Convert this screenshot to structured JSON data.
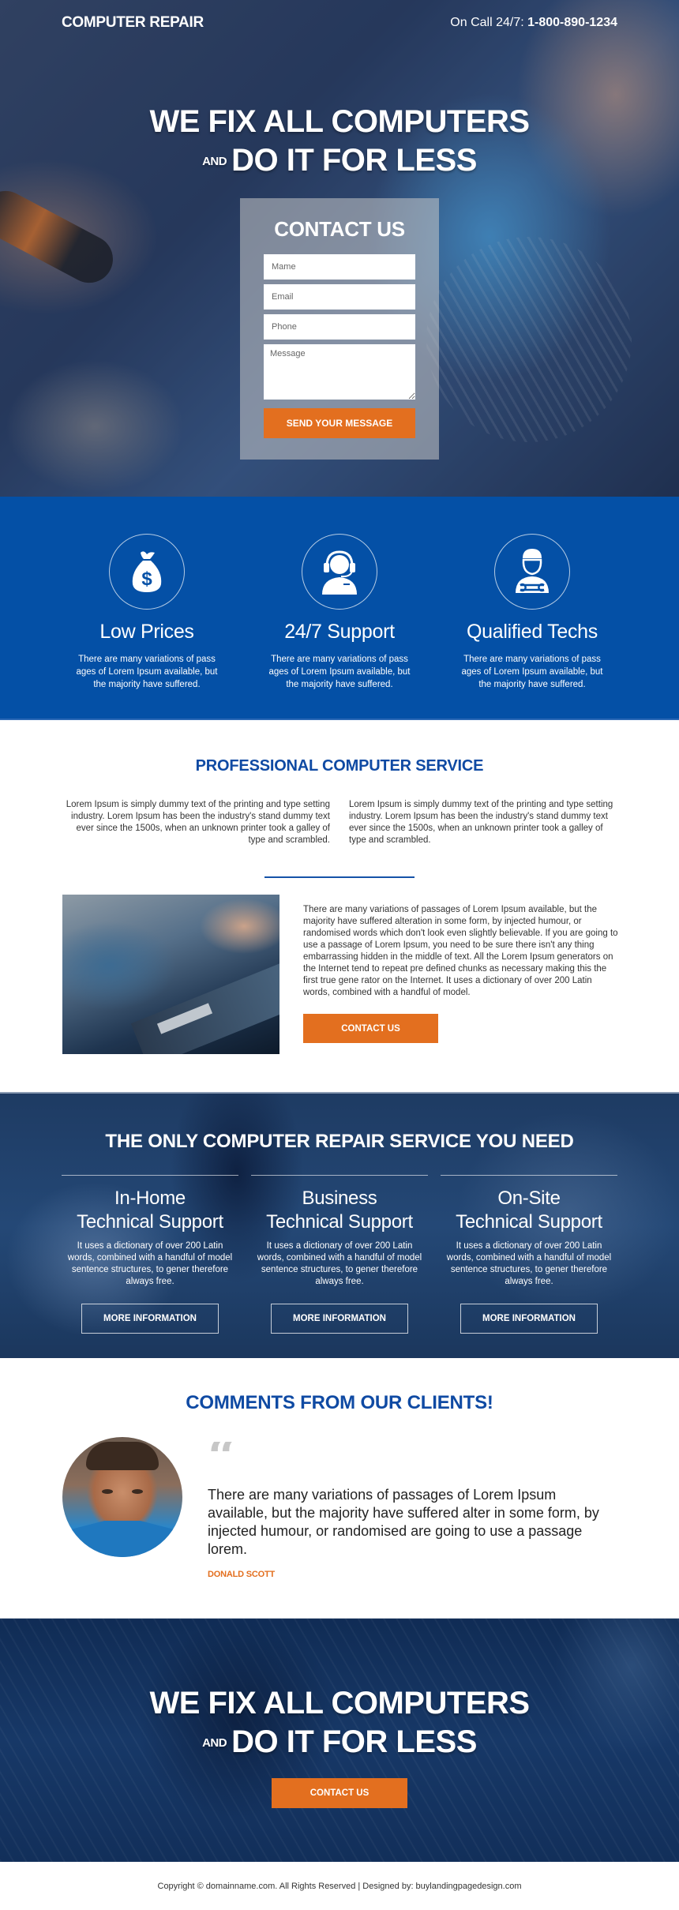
{
  "header": {
    "logo": "COMPUTER REPAIR",
    "oncall_label": "On Call 24/7:",
    "phone": "1-800-890-1234"
  },
  "hero": {
    "headline_line1": "WE FIX ALL COMPUTERS",
    "headline_and": "AND",
    "headline_line2": "DO IT FOR LESS",
    "form": {
      "title": "CONTACT US",
      "name_placeholder": "Mame",
      "email_placeholder": "Email",
      "phone_placeholder": "Phone",
      "message_placeholder": "Message",
      "submit_label": "SEND YOUR MESSAGE"
    }
  },
  "features": [
    {
      "icon": "money-bag-icon",
      "title": "Low Prices",
      "text": "There are many variations of pass ages of Lorem Ipsum available, but the majority have suffered."
    },
    {
      "icon": "headset-support-icon",
      "title": "24/7 Support",
      "text": "There are many variations of pass ages of Lorem Ipsum available, but the majority have suffered."
    },
    {
      "icon": "technician-icon",
      "title": "Qualified Techs",
      "text": "There are many variations of pass ages of Lorem Ipsum available, but the majority have suffered."
    }
  ],
  "professional": {
    "title": "PROFESSIONAL COMPUTER SERVICE",
    "col_left": "Lorem Ipsum is simply dummy text of the printing and type setting industry. Lorem Ipsum has been the industry's stand dummy text ever since the 1500s, when an unknown printer took a galley of type and scrambled.",
    "col_right": "Lorem Ipsum is simply dummy text of the printing and type setting industry. Lorem Ipsum has been the industry's stand dummy text ever since the 1500s, when an unknown printer took a galley of type and scrambled.",
    "body": "There are many variations of passages of Lorem Ipsum available, but the majority have suffered alteration in some form, by injected humour, or randomised words which don't look even slightly believable. If you are going to use a passage of Lorem Ipsum, you need to be sure there isn't any thing embarrassing hidden in the middle of text. All the Lorem Ipsum generators on the Internet tend to repeat pre defined chunks as necessary making this the first true gene rator on the Internet. It uses a dictionary of over 200 Latin words, combined with a handful of model.",
    "button_label": "CONTACT US"
  },
  "services": {
    "title": "THE ONLY COMPUTER REPAIR SERVICE YOU NEED",
    "items": [
      {
        "line1": "In-Home",
        "line2": "Technical Support",
        "text": "It uses a dictionary of over 200 Latin words, combined with a handful of model sentence structures, to gener therefore always free.",
        "button_label": "MORE INFORMATION"
      },
      {
        "line1": "Business",
        "line2": "Technical Support",
        "text": "It uses a dictionary of over 200 Latin words, combined with a handful of model sentence structures, to gener therefore always free.",
        "button_label": "MORE INFORMATION"
      },
      {
        "line1": "On-Site",
        "line2": "Technical Support",
        "text": "It uses a dictionary of over 200 Latin words, combined with a handful of model sentence structures, to gener therefore always free.",
        "button_label": "MORE INFORMATION"
      }
    ]
  },
  "testimonials": {
    "title": "COMMENTS FROM OUR CLIENTS!",
    "quote_mark": "“",
    "quote": "There are many variations of passages of Lorem Ipsum available, but the majority have suffered alter in some form, by injected humour, or randomised are going to use a passage lorem.",
    "author": "DONALD SCOTT"
  },
  "cta": {
    "headline_line1": "WE FIX ALL COMPUTERS",
    "headline_and": "AND",
    "headline_line2": "DO IT FOR LESS",
    "button_label": "CONTACT US"
  },
  "footer": {
    "text": "Copyright © domainname.com. All Rights Reserved | Designed by: buylandingpagedesign.com"
  },
  "colors": {
    "brand_blue": "#0450a6",
    "title_blue": "#0f4aa3",
    "accent_orange": "#e36f1f"
  }
}
